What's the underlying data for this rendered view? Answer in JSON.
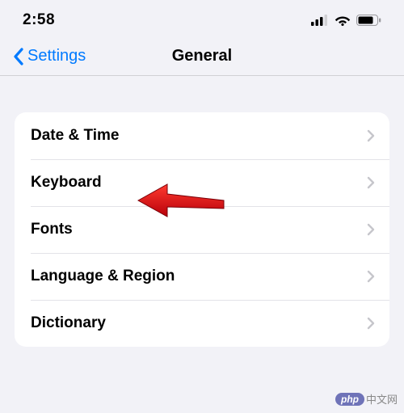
{
  "status": {
    "time": "2:58"
  },
  "nav": {
    "back_label": "Settings",
    "title": "General"
  },
  "rows": {
    "date_time": "Date & Time",
    "keyboard": "Keyboard",
    "fonts": "Fonts",
    "language_region": "Language & Region",
    "dictionary": "Dictionary"
  },
  "watermark": {
    "badge": "php",
    "text": "中文网"
  }
}
